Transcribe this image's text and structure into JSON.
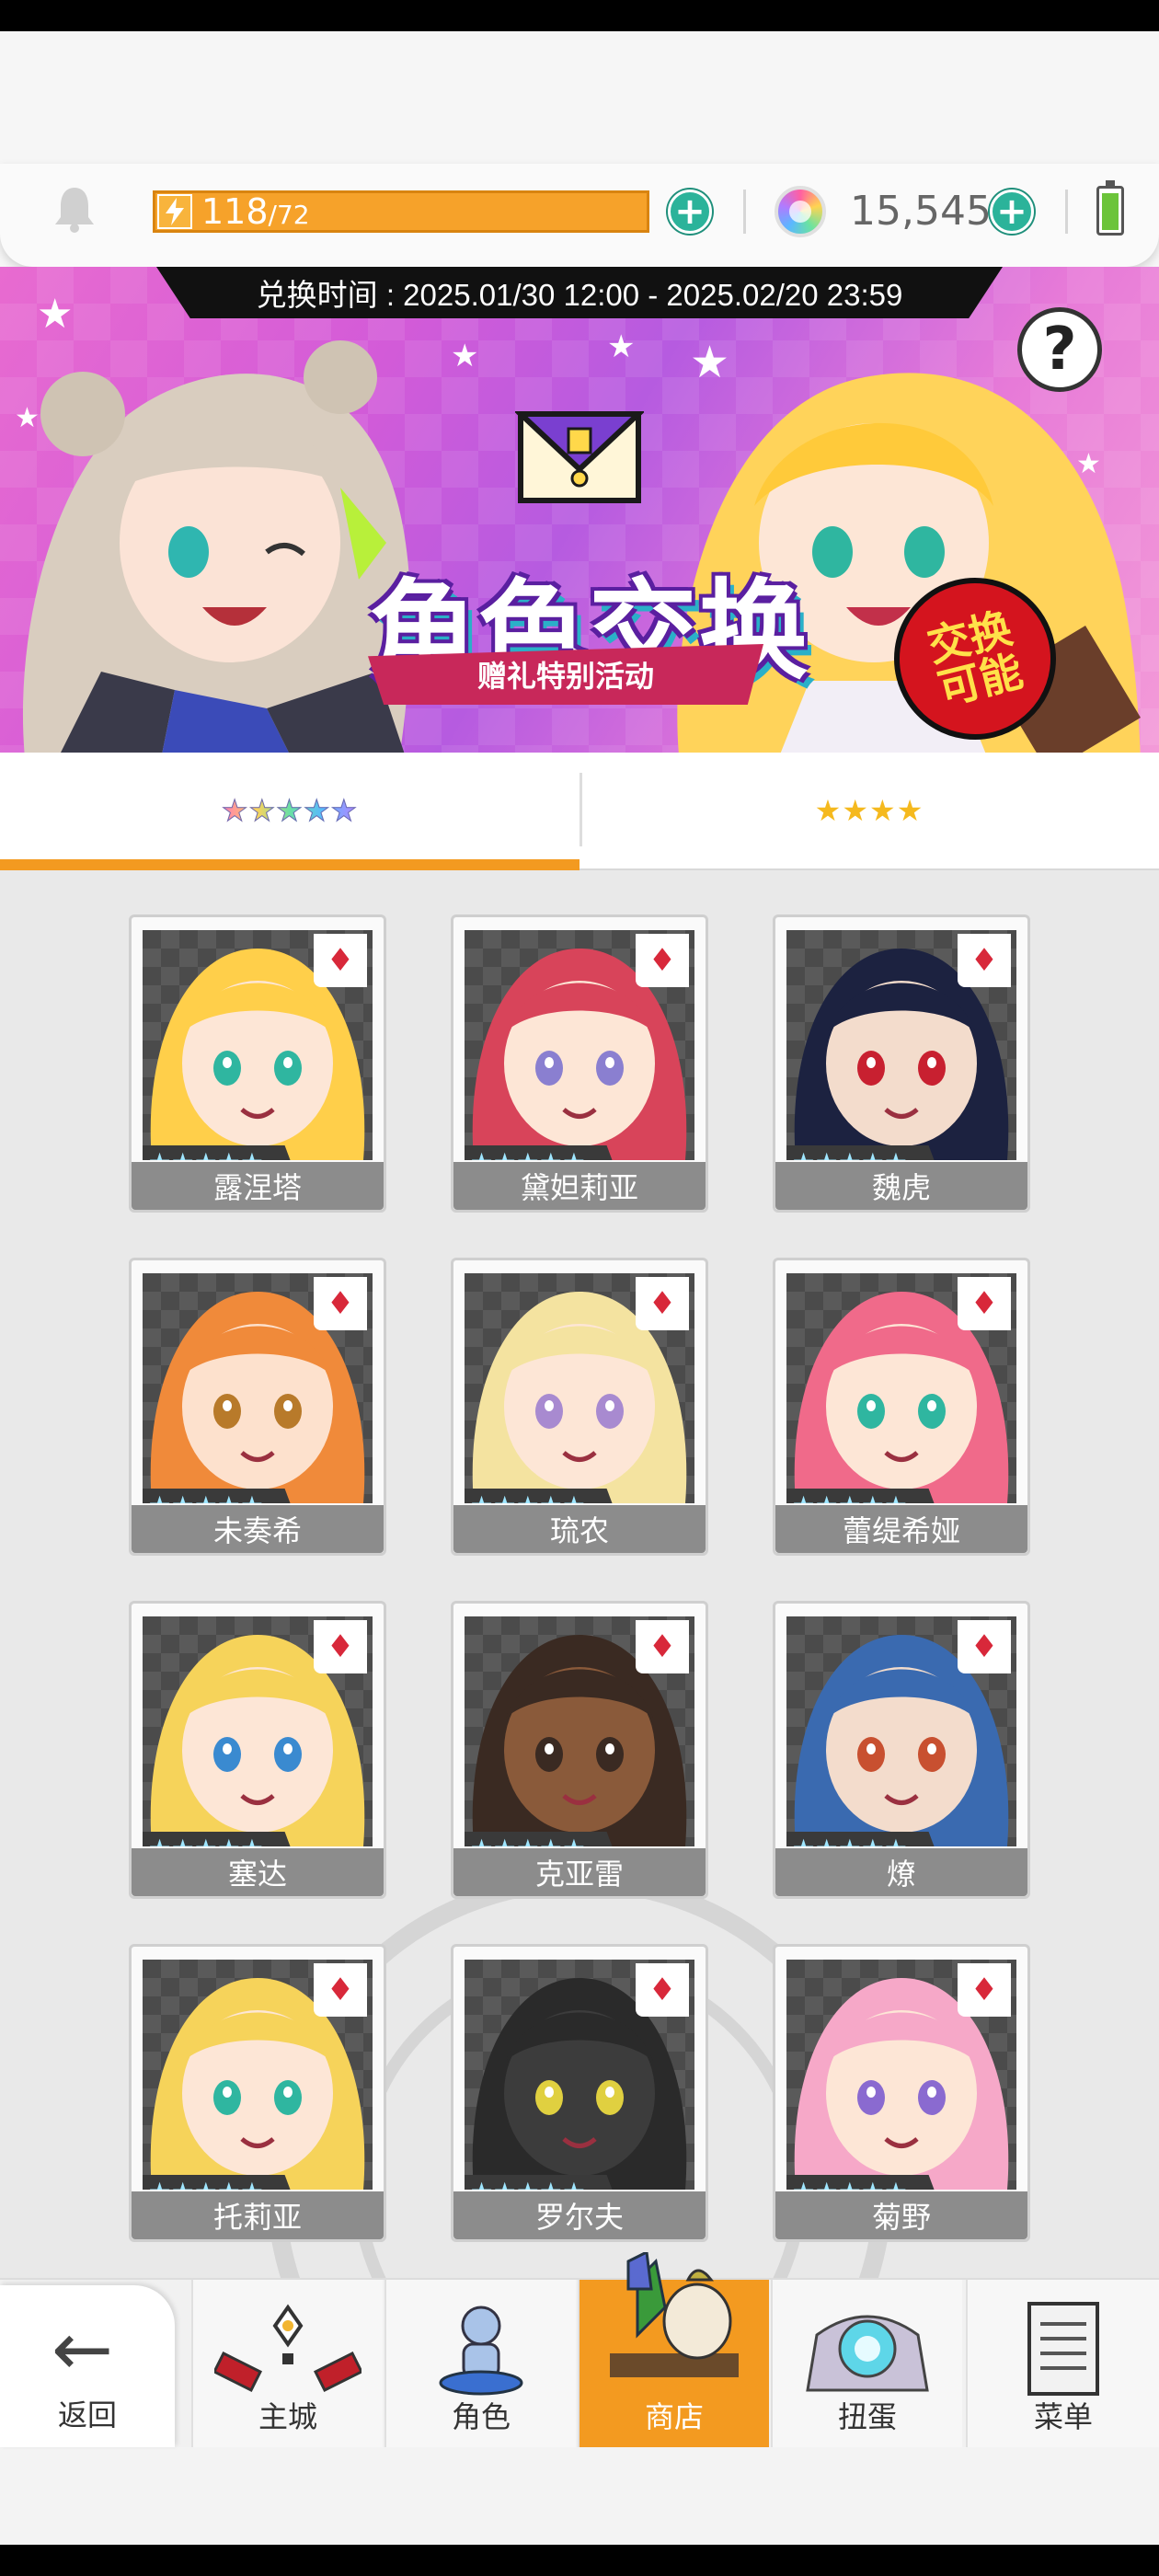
{
  "resources": {
    "energy_current": "118",
    "energy_max": "/72",
    "energy_fill": 1.0,
    "gems": "15,545",
    "battery_level": 0.85
  },
  "banner": {
    "exchange_period": "兑换时间 : 2025.01/30 12:00 - 2025.02/20 23:59",
    "title": "角色交换",
    "subtitle": "赠礼特别活动",
    "badge": "交换\n可能",
    "help": "?"
  },
  "tabs": [
    {
      "label": "★★★★★",
      "active": true
    },
    {
      "label": "★★★★",
      "active": false
    }
  ],
  "characters": [
    {
      "name": "露涅塔",
      "rarity": "★★★★★",
      "suit": "♦"
    },
    {
      "name": "黛妲莉亚",
      "rarity": "★★★★★",
      "suit": "♦"
    },
    {
      "name": "魏虎",
      "rarity": "★★★★★",
      "suit": "♦"
    },
    {
      "name": "未奏希",
      "rarity": "★★★★★",
      "suit": "♦"
    },
    {
      "name": "琉农",
      "rarity": "★★★★★",
      "suit": "♦"
    },
    {
      "name": "蕾缇希娅",
      "rarity": "★★★★★",
      "suit": "♦"
    },
    {
      "name": "塞达",
      "rarity": "★★★★★",
      "suit": "♦"
    },
    {
      "name": "克亚雷",
      "rarity": "★★★★★",
      "suit": "♦"
    },
    {
      "name": "燎",
      "rarity": "★★★★★",
      "suit": "♦"
    },
    {
      "name": "托莉亚",
      "rarity": "★★★★★",
      "suit": "♦"
    },
    {
      "name": "罗尔夫",
      "rarity": "★★★★★",
      "suit": "♦"
    },
    {
      "name": "菊野",
      "rarity": "★★★★★",
      "suit": "♦"
    }
  ],
  "nav": {
    "back": "返回",
    "items": [
      {
        "label": "主城",
        "icon": "castle-icon"
      },
      {
        "label": "角色",
        "icon": "character-icon"
      },
      {
        "label": "商店",
        "icon": "shop-icon",
        "active": true
      },
      {
        "label": "扭蛋",
        "icon": "gacha-icon"
      },
      {
        "label": "菜单",
        "icon": "menu-icon"
      }
    ]
  },
  "colors": {
    "accent": "#f39a20",
    "plus": "#2bb39a",
    "suit": "#d8283a"
  }
}
